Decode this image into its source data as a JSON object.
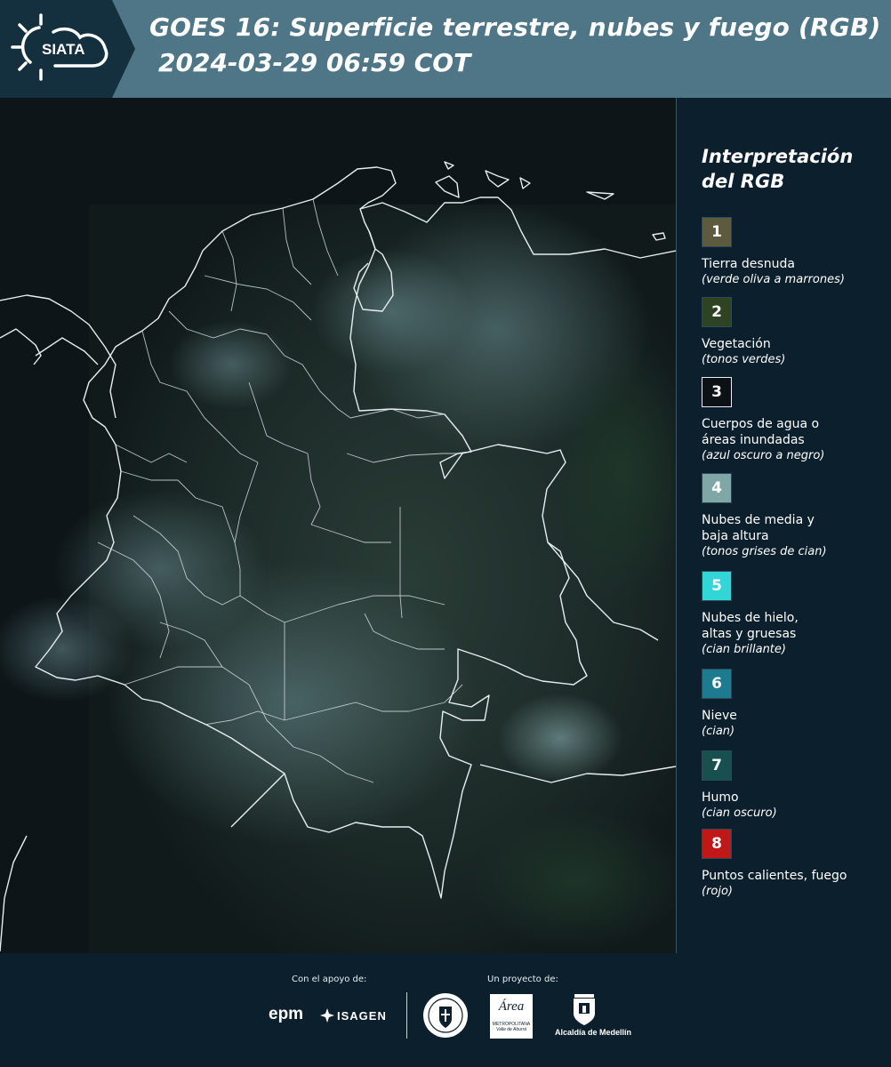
{
  "header": {
    "logo_text": "SIATA",
    "title_line1": "GOES 16: Superficie terrestre, nubes y fuego (RGB)",
    "title_line2": "2024-03-29 06:59 COT"
  },
  "legend": {
    "title_line1": "Interpretación",
    "title_line2": "del RGB",
    "items": [
      {
        "number": "1",
        "color": "#5e5a40",
        "label": "Tierra desnuda",
        "hint": "(verde oliva a marrones)"
      },
      {
        "number": "2",
        "color": "#2e4323",
        "label": "Vegetación",
        "hint": "(tonos verdes)"
      },
      {
        "number": "3",
        "color": "#0b1114",
        "label": "Cuerpos de agua o áreas inundadas",
        "hint": "(azul oscuro a negro)"
      },
      {
        "number": "4",
        "color": "#7ea7a6",
        "label": "Nubes de media y baja altura",
        "hint": "(tonos grises de cian)"
      },
      {
        "number": "5",
        "color": "#33d6d6",
        "label": "Nubes de hielo, altas y gruesas",
        "hint": "(cian brillante)"
      },
      {
        "number": "6",
        "color": "#1e7a8f",
        "label": "Nieve",
        "hint": "(cian)"
      },
      {
        "number": "7",
        "color": "#18504f",
        "label": "Humo",
        "hint": "(cian oscuro)"
      },
      {
        "number": "8",
        "color": "#c01818",
        "label": "Puntos calientes, fuego",
        "hint": "(rojo)"
      }
    ]
  },
  "footer": {
    "support_label": "Con el apoyo de:",
    "project_label": "Un proyecto de:",
    "epm_text": "epm",
    "isagen_text": "ISAGEN",
    "area_text": "Área",
    "area_sub1": "METROPOLITANA",
    "area_sub2": "Valle de Aburrá",
    "alcaldia_text": "Alcaldía de Medellín"
  }
}
